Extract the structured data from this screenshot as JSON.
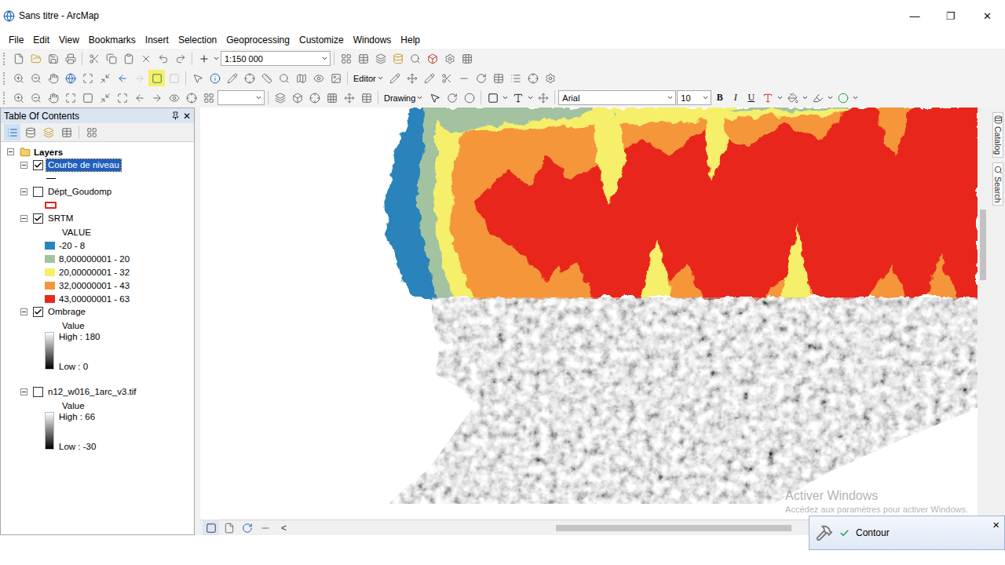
{
  "window": {
    "title": "Sans titre - ArcMap",
    "controls": [
      "—",
      "❐",
      "✕"
    ]
  },
  "menu": [
    "File",
    "Edit",
    "View",
    "Bookmarks",
    "Insert",
    "Selection",
    "Geoprocessing",
    "Customize",
    "Windows",
    "Help"
  ],
  "toolbar": {
    "scale": "1:150 000",
    "editor": "Editor",
    "drawing": "Drawing",
    "font": "Arial",
    "font_size": "10",
    "format_buttons": [
      "B",
      "I",
      "U"
    ]
  },
  "toc": {
    "title": "Table Of Contents",
    "close": "✕",
    "group": {
      "name": "Layers",
      "expanded": true
    },
    "layers": [
      {
        "name": "Courbe de niveau",
        "checked": true,
        "expanded": true,
        "selected": true,
        "legend": {
          "kind": "line",
          "color": "#000000"
        }
      },
      {
        "name": "Dépt_Goudomp",
        "checked": false,
        "expanded": true,
        "selected": false,
        "legend": {
          "kind": "polygon",
          "color": "#e0261c"
        }
      },
      {
        "name": "SRTM",
        "checked": true,
        "expanded": true,
        "selected": false,
        "legend": {
          "kind": "classes",
          "heading": "VALUE",
          "classes": [
            {
              "label": "-20 - 8",
              "color": "#2b83ba"
            },
            {
              "label": "8,000000001 - 20",
              "color": "#a3c2a0"
            },
            {
              "label": "20,00000001 - 32",
              "color": "#f5ef6b"
            },
            {
              "label": "32,00000001 - 43",
              "color": "#f5963a"
            },
            {
              "label": "43,00000001 - 63",
              "color": "#e8281c"
            }
          ]
        }
      },
      {
        "name": "Ombrage",
        "checked": true,
        "expanded": true,
        "selected": false,
        "legend": {
          "kind": "stretch",
          "heading": "Value",
          "high": "High : 180",
          "low": "Low : 0"
        }
      },
      {
        "name": "n12_w016_1arc_v3.tif",
        "checked": false,
        "expanded": true,
        "selected": false,
        "legend": {
          "kind": "stretch",
          "heading": "Value",
          "high": "High : 66",
          "low": "Low : -30"
        }
      }
    ]
  },
  "map": {
    "watermark": [
      "Activer Windows",
      "Accédez aux paramètres pour activer Windows."
    ]
  },
  "side_tabs": [
    "Catalog",
    "Search"
  ],
  "status_bar": {
    "scroll": "<"
  },
  "notification": {
    "title": "Contour",
    "close": "×"
  }
}
